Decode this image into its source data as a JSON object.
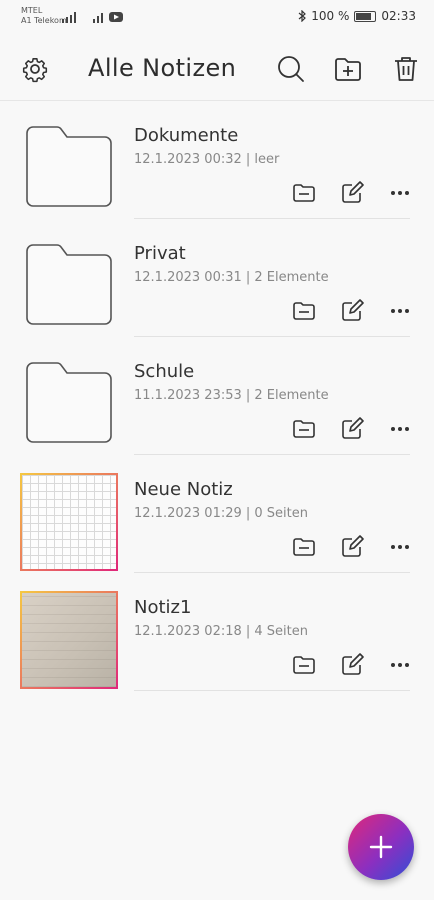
{
  "status_bar": {
    "carrier_line1": "MTEL",
    "carrier_line2": "A1 Telekom",
    "battery": "100 %",
    "time": "02:33"
  },
  "header": {
    "title": "Alle Notizen",
    "icons": [
      "gear-icon",
      "search-icon",
      "new-folder-icon",
      "trash-icon"
    ]
  },
  "items": [
    {
      "type": "folder",
      "title": "Dokumente",
      "meta": "12.1.2023 00:32 | leer"
    },
    {
      "type": "folder",
      "title": "Privat",
      "meta": "12.1.2023 00:31 | 2 Elemente"
    },
    {
      "type": "folder",
      "title": "Schule",
      "meta": "11.1.2023 23:53 | 2 Elemente"
    },
    {
      "type": "note",
      "title": "Neue Notiz",
      "meta": "12.1.2023 01:29 | 0 Seiten"
    },
    {
      "type": "note",
      "title": "Notiz1",
      "meta": "12.1.2023 02:18 | 4 Seiten"
    }
  ],
  "row_actions": [
    "move-folder-icon",
    "edit-icon",
    "more-icon"
  ],
  "colors": {
    "fab_gradient": [
      "#e0287a",
      "#8b2fc0",
      "#2f4fd6"
    ],
    "note_border_gradient": [
      "#f5c842",
      "#e0287a"
    ]
  }
}
